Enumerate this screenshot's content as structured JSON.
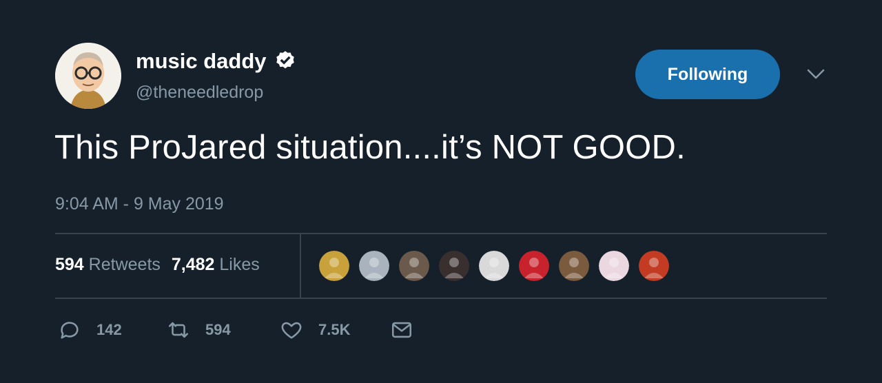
{
  "user": {
    "display_name": "music daddy",
    "handle": "@theneedledrop",
    "verified": true
  },
  "follow_button": {
    "label": "Following",
    "color": "#1a6fad"
  },
  "tweet": {
    "text": "This ProJared situation....it’s NOT GOOD.",
    "timestamp": "9:04 AM - 9 May 2019"
  },
  "stats": {
    "retweets_count": "594",
    "retweets_label": "Retweets",
    "likes_count": "7,482",
    "likes_label": "Likes"
  },
  "likers": [
    {
      "name": "liker-1-avatar",
      "color": "#c9a13b"
    },
    {
      "name": "liker-2-avatar",
      "color": "#a8b3bd"
    },
    {
      "name": "liker-3-avatar",
      "color": "#6b5a4b"
    },
    {
      "name": "liker-4-avatar",
      "color": "#3a2f2f"
    },
    {
      "name": "liker-5-avatar",
      "color": "#d9d9d9"
    },
    {
      "name": "liker-6-avatar",
      "color": "#c8232c"
    },
    {
      "name": "liker-7-avatar",
      "color": "#7a5b3e"
    },
    {
      "name": "liker-8-avatar",
      "color": "#ead7e0"
    },
    {
      "name": "liker-9-avatar",
      "color": "#c23b22"
    }
  ],
  "actions": {
    "reply_count": "142",
    "retweet_count": "594",
    "like_count": "7.5K"
  },
  "colors": {
    "background": "#15202b",
    "secondary_text": "#8899a6",
    "divider": "#38444d"
  }
}
